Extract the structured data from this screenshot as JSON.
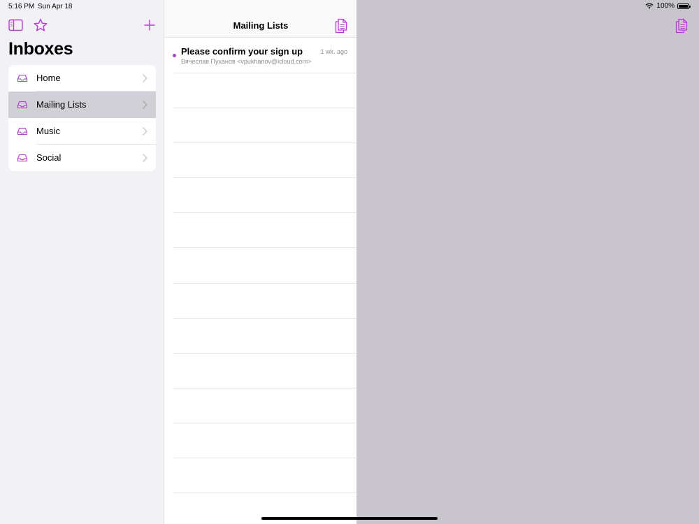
{
  "status_bar": {
    "time": "5:16 PM",
    "date": "Sun Apr 18",
    "battery": "100%"
  },
  "sidebar": {
    "title": "Inboxes",
    "toolbar_icons": [
      "sidebar-icon",
      "star-icon",
      "plus-icon"
    ],
    "inboxes": [
      {
        "label": "Home",
        "selected": false
      },
      {
        "label": "Mailing Lists",
        "selected": true
      },
      {
        "label": "Music",
        "selected": false
      },
      {
        "label": "Social",
        "selected": false
      }
    ]
  },
  "message_list": {
    "title": "Mailing Lists",
    "messages": [
      {
        "subject": "Please confirm your sign up",
        "sender": "Вячеслав Пуханов <vpukhanov@icloud.com>",
        "time": "1 wk. ago",
        "unread": true
      }
    ]
  },
  "colors": {
    "accent": "#b23ecf",
    "sidebar_bg": "#f2f1f6",
    "detail_bg": "#c8c6cc",
    "selected_row": "#d1d0d6"
  }
}
